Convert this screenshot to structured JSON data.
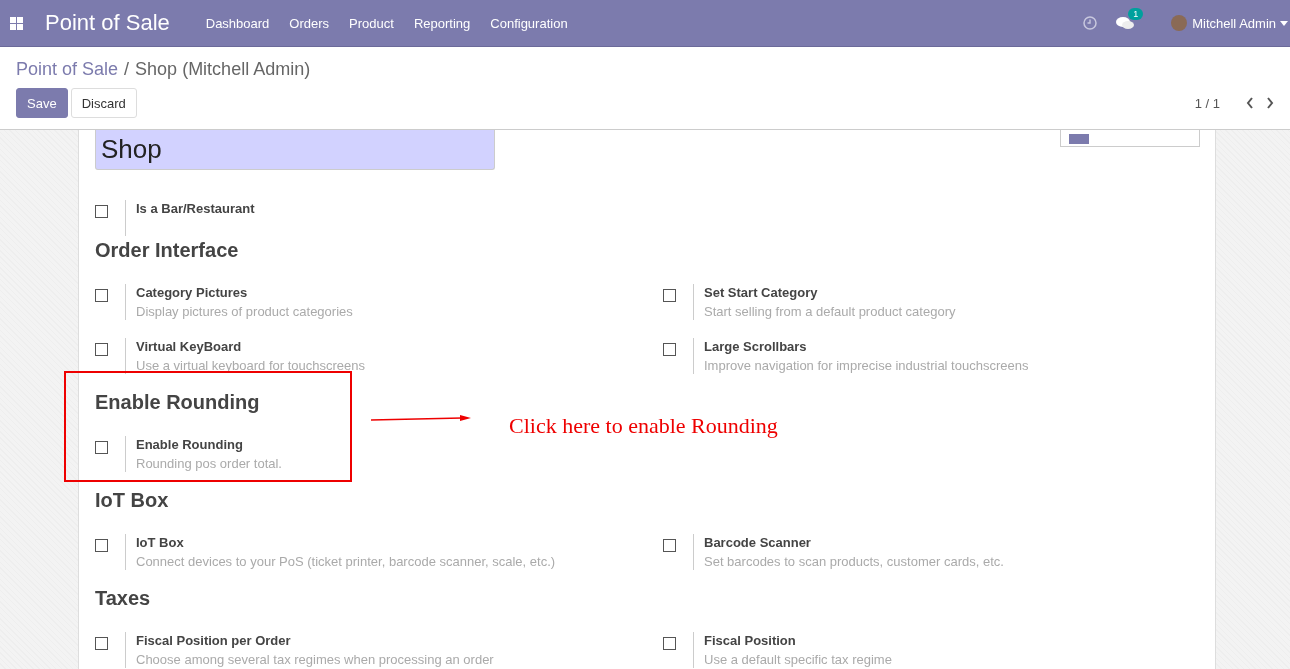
{
  "navbar": {
    "app_title": "Point of Sale",
    "menu": [
      "Dashboard",
      "Orders",
      "Product",
      "Reporting",
      "Configuration"
    ],
    "messages_badge": "1",
    "user": "Mitchell Admin"
  },
  "breadcrumb": {
    "parent": "Point of Sale",
    "separator": "/",
    "current": "Shop (Mitchell Admin)"
  },
  "buttons": [
    {
      "label": "Save",
      "kind": "primary"
    },
    {
      "label": "Discard",
      "kind": "secondary"
    }
  ],
  "pager": {
    "value": "1 / 1"
  },
  "form": {
    "name": "Shop",
    "sections": [
      {
        "settings": [
          {
            "title": "Is a Bar/Restaurant",
            "checked": false
          }
        ]
      },
      {
        "heading": "Order Interface",
        "settings": [
          {
            "title": "Category Pictures",
            "description": "Display pictures of product categories",
            "checked": false
          },
          {
            "title": "Set Start Category",
            "description": "Start selling from a default product category",
            "checked": false
          },
          {
            "title": "Virtual KeyBoard",
            "description": "Use a virtual keyboard for touchscreens",
            "checked": false
          },
          {
            "title": "Large Scrollbars",
            "description": "Improve navigation for imprecise industrial touchscreens",
            "checked": false
          }
        ]
      },
      {
        "heading": "Enable Rounding",
        "settings": [
          {
            "title": "Enable Rounding",
            "description": "Rounding pos order total.",
            "checked": false
          }
        ]
      },
      {
        "heading": "IoT Box",
        "settings": [
          {
            "title": "IoT Box",
            "description": "Connect devices to your PoS (ticket printer, barcode scanner, scale, etc.)",
            "checked": false
          },
          {
            "title": "Barcode Scanner",
            "description": "Set barcodes to scan products, customer cards, etc.",
            "checked": false
          }
        ]
      },
      {
        "heading": "Taxes",
        "settings": [
          {
            "title": "Fiscal Position per Order",
            "description": "Choose among several tax regimes when processing an order",
            "checked": false
          },
          {
            "title": "Fiscal Position",
            "description": "Use a default specific tax regime",
            "checked": false
          }
        ]
      }
    ]
  },
  "annotation": {
    "text": "Click here to enable Rounding"
  }
}
